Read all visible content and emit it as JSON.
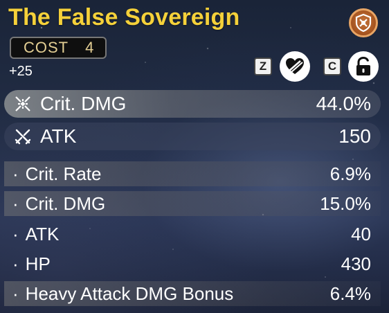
{
  "echo": {
    "name": "The False Sovereign",
    "cost_label": "COST",
    "cost_value": "4",
    "level": "+25",
    "faction_icon": "faction-emblem-icon"
  },
  "controls": {
    "discard_key": "Z",
    "lock_key": "C",
    "discard_icon": "discard-heart-icon",
    "lock_icon": "unlock-padlock-icon"
  },
  "main_stats": [
    {
      "name": "Crit. DMG",
      "value": "44.0%",
      "icon": "crit-dmg-icon"
    },
    {
      "name": "ATK",
      "value": "150",
      "icon": "atk-swords-icon"
    }
  ],
  "sub_stats": [
    {
      "name": "Crit. Rate",
      "value": "6.9%"
    },
    {
      "name": "Crit. DMG",
      "value": "15.0%"
    },
    {
      "name": "ATK",
      "value": "40"
    },
    {
      "name": "HP",
      "value": "430"
    },
    {
      "name": "Heavy Attack DMG Bonus",
      "value": "6.4%"
    }
  ],
  "bullet": "·",
  "colors": {
    "title": "#f5d13a",
    "cost_text": "#e4cf94",
    "faction_badge": "#a3521e"
  }
}
